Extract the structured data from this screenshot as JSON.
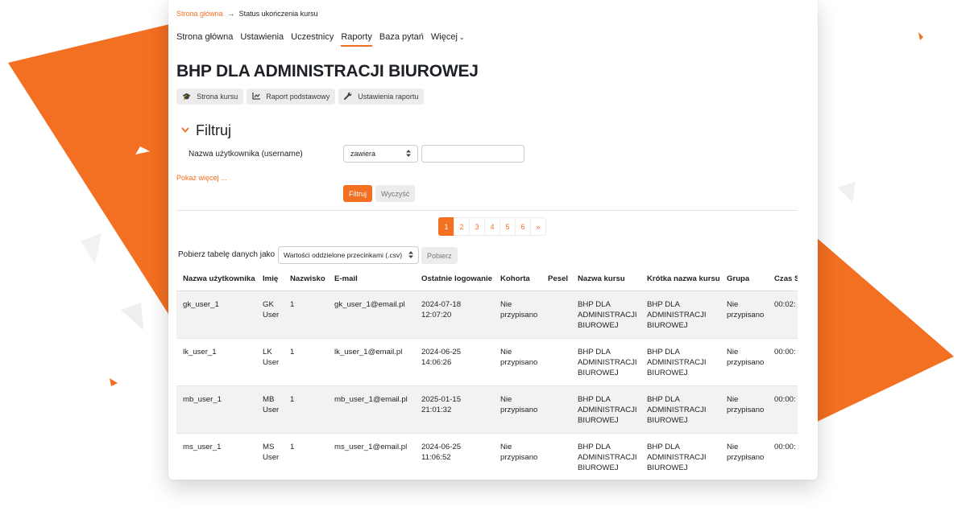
{
  "breadcrumb": {
    "home": "Strona główna",
    "separator": "→",
    "current": "Status ukończenia kursu"
  },
  "nav": {
    "items": [
      "Strona główna",
      "Ustawienia",
      "Uczestnicy",
      "Raporty",
      "Baza pytań"
    ],
    "active": "Raporty",
    "more": "Więcej"
  },
  "page_title": "BHP DLA ADMINISTRACJI BIUROWEJ",
  "actions": {
    "course_page": "Strona kursu",
    "basic_report": "Raport podstawowy",
    "report_settings": "Ustawienia raportu"
  },
  "filter": {
    "heading": "Filtruj",
    "field_label": "Nazwa użytkownika (username)",
    "operator": "zawiera",
    "value": "",
    "show_more": "Pokaż więcej ...",
    "apply": "Filtruj",
    "clear": "Wyczyść"
  },
  "pagination": {
    "pages": [
      "1",
      "2",
      "3",
      "4",
      "5",
      "6"
    ],
    "current": "1",
    "next": "»"
  },
  "download": {
    "label": "Pobierz tabelę danych jako",
    "format": "Wartości oddzielone przecinkami (.csv)",
    "button": "Pobierz"
  },
  "table": {
    "columns": [
      "Nazwa użytkownika",
      "Imię",
      "Nazwisko",
      "E-mail",
      "Ostatnie logowanie",
      "Kohorta",
      "Pesel",
      "Nazwa kursu",
      "Krótka nazwa kursu",
      "Grupa",
      "Czas S"
    ],
    "rows": [
      {
        "username": "gk_user_1",
        "firstname": "GK User",
        "lastname": "1",
        "email": "gk_user_1@email.pl",
        "last_login": "2024-07-18 12:07:20",
        "cohort": "Nie przypisano",
        "pesel": "",
        "course": "BHP DLA ADMINISTRACJI BIUROWEJ",
        "short": "BHP DLA ADMINISTRACJI BIUROWEJ",
        "group": "Nie przypisano",
        "time": "00:02:"
      },
      {
        "username": "lk_user_1",
        "firstname": "LK User",
        "lastname": "1",
        "email": "lk_user_1@email.pl",
        "last_login": "2024-06-25 14:06:26",
        "cohort": "Nie przypisano",
        "pesel": "",
        "course": "BHP DLA ADMINISTRACJI BIUROWEJ",
        "short": "BHP DLA ADMINISTRACJI BIUROWEJ",
        "group": "Nie przypisano",
        "time": "00:00:"
      },
      {
        "username": "mb_user_1",
        "firstname": "MB User",
        "lastname": "1",
        "email": "mb_user_1@email.pl",
        "last_login": "2025-01-15 21:01:32",
        "cohort": "Nie przypisano",
        "pesel": "",
        "course": "BHP DLA ADMINISTRACJI BIUROWEJ",
        "short": "BHP DLA ADMINISTRACJI BIUROWEJ",
        "group": "Nie przypisano",
        "time": "00:00:"
      },
      {
        "username": "ms_user_1",
        "firstname": "MS User",
        "lastname": "1",
        "email": "ms_user_1@email.pl",
        "last_login": "2024-06-25 11:06:52",
        "cohort": "Nie przypisano",
        "pesel": "",
        "course": "BHP DLA ADMINISTRACJI BIUROWEJ",
        "short": "BHP DLA ADMINISTRACJI BIUROWEJ",
        "group": "Nie przypisano",
        "time": "00:00:"
      }
    ]
  },
  "icons": {
    "course": "graduation-cap-icon",
    "report": "chart-icon",
    "settings": "wrench-icon",
    "collapse": "chevron-down-icon",
    "select": "sort-arrows-icon"
  },
  "colors": {
    "accent": "#f36f21",
    "button_gray": "#ececec",
    "row_stripe": "#f2f2f2"
  }
}
